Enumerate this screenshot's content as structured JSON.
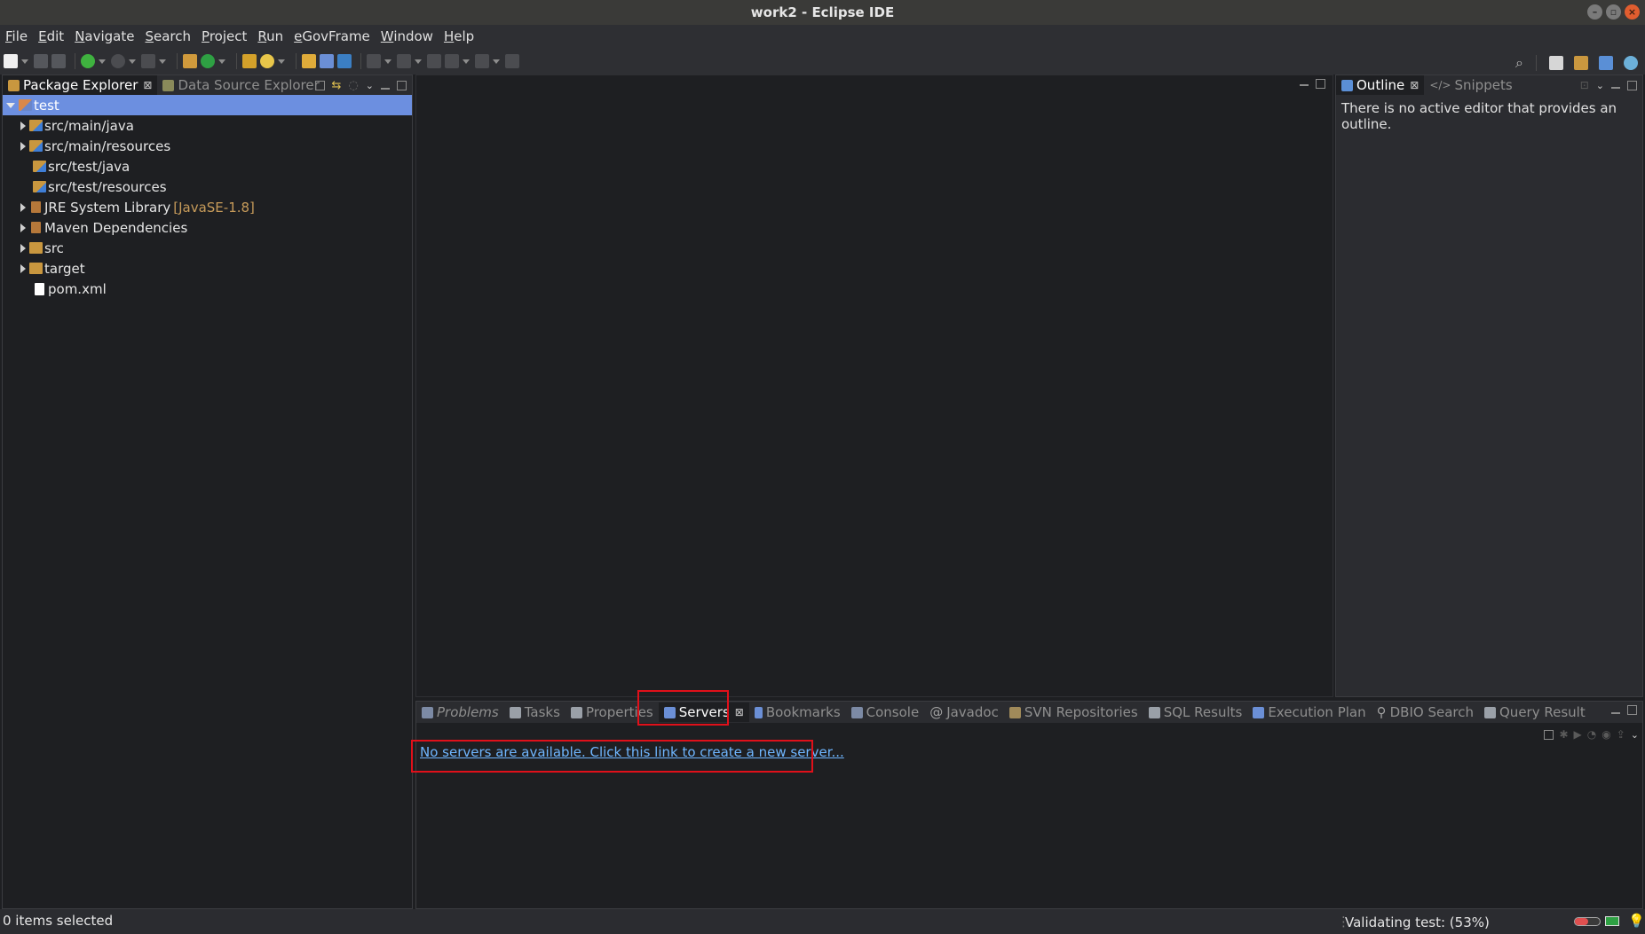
{
  "window": {
    "title": "work2 - Eclipse IDE"
  },
  "menu": [
    {
      "mnemonic": "F",
      "rest": "ile"
    },
    {
      "mnemonic": "E",
      "rest": "dit"
    },
    {
      "mnemonic": "N",
      "rest": "avigate"
    },
    {
      "mnemonic": "S",
      "rest": "earch"
    },
    {
      "mnemonic": "P",
      "rest": "roject"
    },
    {
      "mnemonic": "R",
      "rest": "un"
    },
    {
      "mnemonic": "e",
      "rest": "GovFrame"
    },
    {
      "mnemonic": "W",
      "rest": "indow"
    },
    {
      "mnemonic": "H",
      "rest": "elp"
    }
  ],
  "left_panel": {
    "tabs": [
      {
        "label": "Package Explorer",
        "close": "⊠"
      },
      {
        "label": "Data Source Explorer"
      }
    ],
    "tree": [
      {
        "label": "test"
      },
      {
        "label": "src/main/java"
      },
      {
        "label": "src/main/resources"
      },
      {
        "label": "src/test/java"
      },
      {
        "label": "src/test/resources"
      },
      {
        "label": "JRE System Library",
        "decoration": "[JavaSE-1.8]"
      },
      {
        "label": "Maven Dependencies"
      },
      {
        "label": "src"
      },
      {
        "label": "target"
      },
      {
        "label": "pom.xml"
      }
    ]
  },
  "right_panel": {
    "tabs": [
      {
        "label": "Outline",
        "close": "⊠"
      },
      {
        "label": "Snippets"
      }
    ],
    "message": "There is no active editor that provides an outline."
  },
  "bottom_panel": {
    "tabs": [
      {
        "label": "Problems"
      },
      {
        "label": "Tasks"
      },
      {
        "label": "Properties"
      },
      {
        "label": "Servers",
        "close": "⊠"
      },
      {
        "label": "Bookmarks"
      },
      {
        "label": "Console"
      },
      {
        "label": "Javadoc"
      },
      {
        "label": "SVN Repositories"
      },
      {
        "label": "SQL Results"
      },
      {
        "label": "Execution Plan"
      },
      {
        "label": "DBIO Search"
      },
      {
        "label": "Query Result"
      }
    ],
    "servers_link": "No servers are available. Click this link to create a new server..."
  },
  "status": {
    "selection": "0 items selected",
    "progress": "Validating test: (53%)"
  },
  "colors": {
    "selection": "#6c8fe0",
    "link": "#6fb6ff",
    "highlight_box": "#e0101a"
  }
}
